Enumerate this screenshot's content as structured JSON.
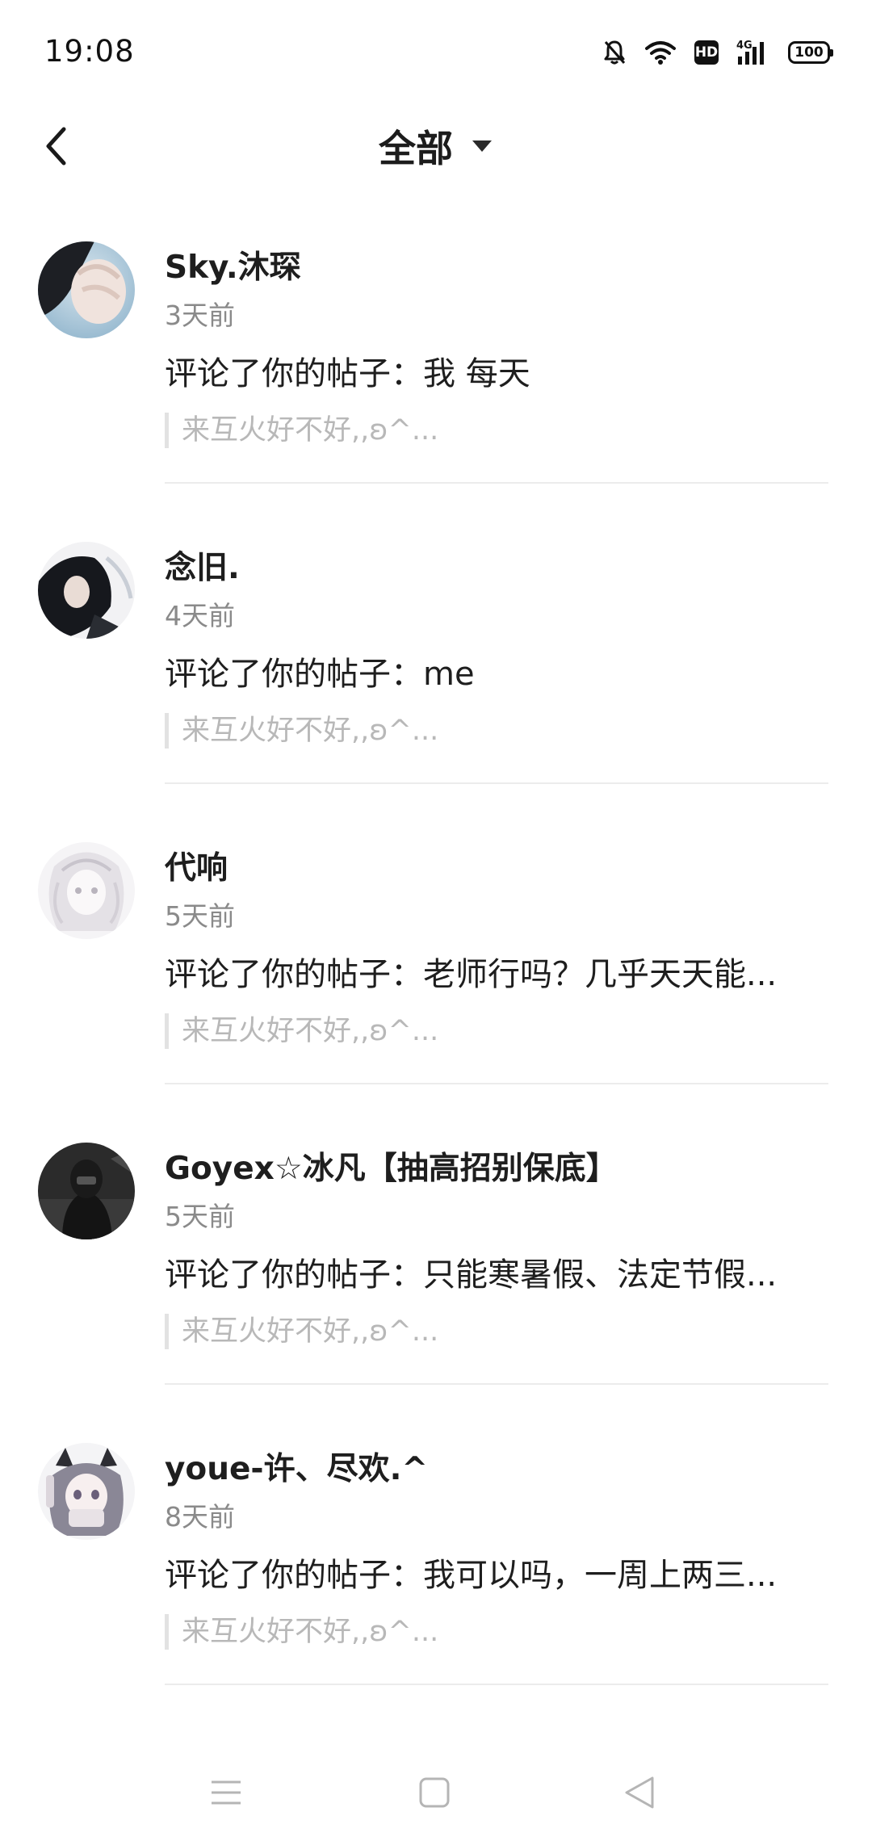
{
  "status_bar": {
    "time": "19:08",
    "icons": [
      "bell-off-icon",
      "wifi-icon",
      "hd-icon",
      "signal-4g-icon",
      "battery-icon"
    ],
    "hd_label": "HD",
    "network_label": "4G",
    "battery_level": "100"
  },
  "header": {
    "title": "全部",
    "back_icon": "chevron-left-icon",
    "dropdown_icon": "triangle-down-icon"
  },
  "notifications": [
    {
      "name": "Sky.沐琛",
      "time": "3天前",
      "content": "评论了你的帖子：我  每天",
      "quote": "来互火好不好,,ʚ^..."
    },
    {
      "name": "念旧.",
      "time": "4天前",
      "content": "评论了你的帖子：me",
      "quote": "来互火好不好,,ʚ^..."
    },
    {
      "name": "代响",
      "time": "5天前",
      "content": "评论了你的帖子：老师行吗？几乎天天能...",
      "quote": "来互火好不好,,ʚ^..."
    },
    {
      "name": "Goyex☆冰凡【抽高招别保底】",
      "time": "5天前",
      "content": "评论了你的帖子：只能寒暑假、法定节假...",
      "quote": "来互火好不好,,ʚ^..."
    },
    {
      "name": "youe-许、尽欢.^",
      "time": "8天前",
      "content": "评论了你的帖子：我可以吗，一周上两三...",
      "quote": "来互火好不好,,ʚ^..."
    }
  ],
  "nav_bar": {
    "icons": [
      "menu-icon",
      "home-square-icon",
      "back-triangle-icon"
    ]
  },
  "colors": {
    "text_primary": "#1e1e1e",
    "text_secondary": "#8a8a8a",
    "text_quote": "#b8b8b8",
    "divider": "#ececec"
  }
}
